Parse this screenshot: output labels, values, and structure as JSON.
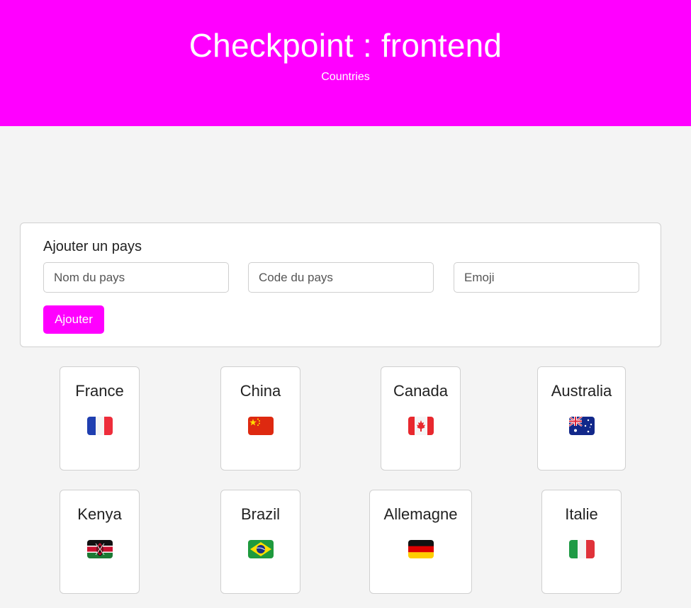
{
  "header": {
    "title": "Checkpoint : frontend",
    "subtitle": "Countries",
    "accent_color": "#ff00ff"
  },
  "form": {
    "heading": "Ajouter un pays",
    "name_placeholder": "Nom du pays",
    "code_placeholder": "Code du pays",
    "emoji_placeholder": "Emoji",
    "submit_label": "Ajouter"
  },
  "countries": [
    {
      "name": "France",
      "flag": "flag-france-icon"
    },
    {
      "name": "China",
      "flag": "flag-china-icon"
    },
    {
      "name": "Canada",
      "flag": "flag-canada-icon"
    },
    {
      "name": "Australia",
      "flag": "flag-australia-icon"
    },
    {
      "name": "Kenya",
      "flag": "flag-kenya-icon"
    },
    {
      "name": "Brazil",
      "flag": "flag-brazil-icon"
    },
    {
      "name": "Allemagne",
      "flag": "flag-germany-icon"
    },
    {
      "name": "Italie",
      "flag": "flag-italy-icon"
    }
  ]
}
